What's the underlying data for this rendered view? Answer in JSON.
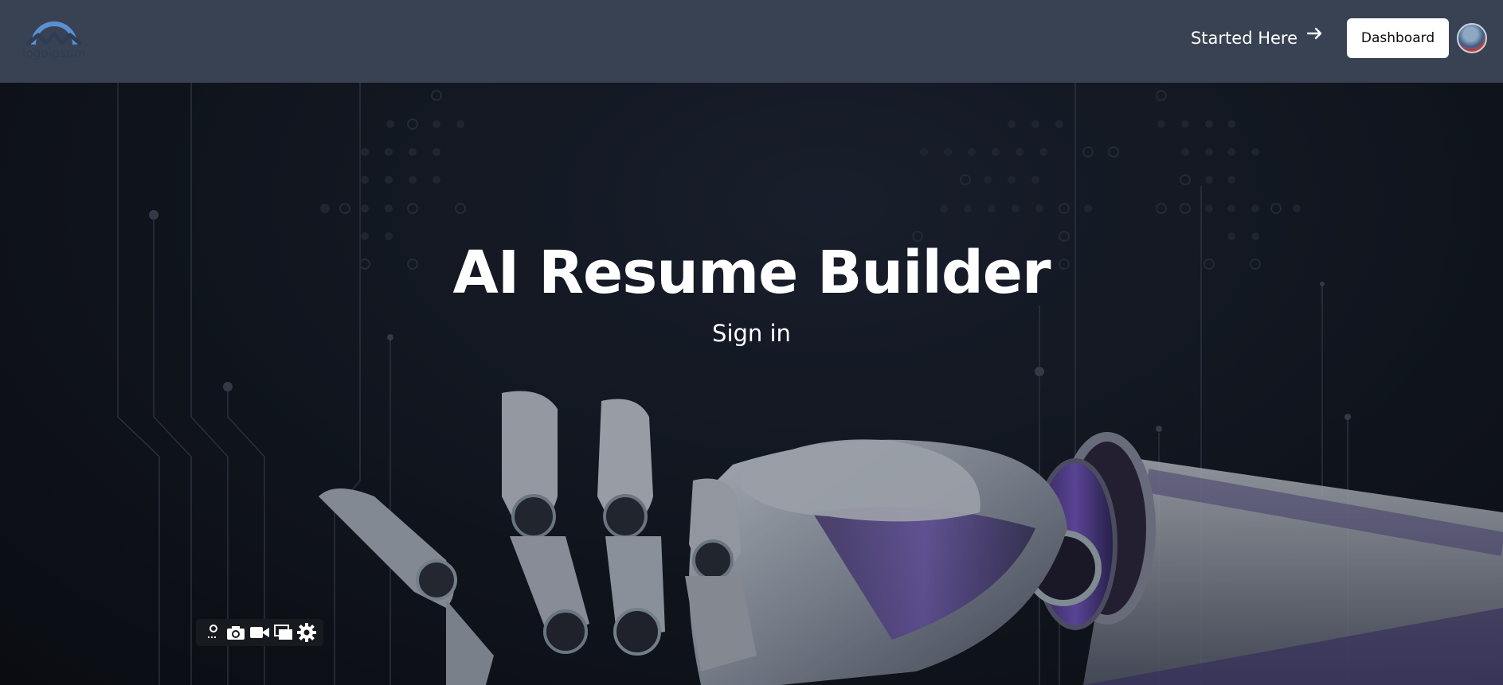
{
  "header": {
    "logo": {
      "text": "logoipsum",
      "icon": "logo-arch-icon",
      "color": "#5b8fd6"
    },
    "started_link": {
      "label": "Started Here",
      "icon": "arrow-right-icon"
    },
    "dashboard_button": {
      "label": "Dashboard"
    },
    "avatar": {
      "icon": "user-avatar"
    },
    "background": "#394253"
  },
  "hero": {
    "title": "AI Resume Builder",
    "subtitle": "Sign in",
    "background_image": "robot-hand-circuit"
  },
  "capture_toolbar": {
    "tools": [
      {
        "name": "edit-icon"
      },
      {
        "name": "camera-icon"
      },
      {
        "name": "video-icon"
      },
      {
        "name": "window-icon"
      },
      {
        "name": "gear-icon"
      }
    ]
  }
}
